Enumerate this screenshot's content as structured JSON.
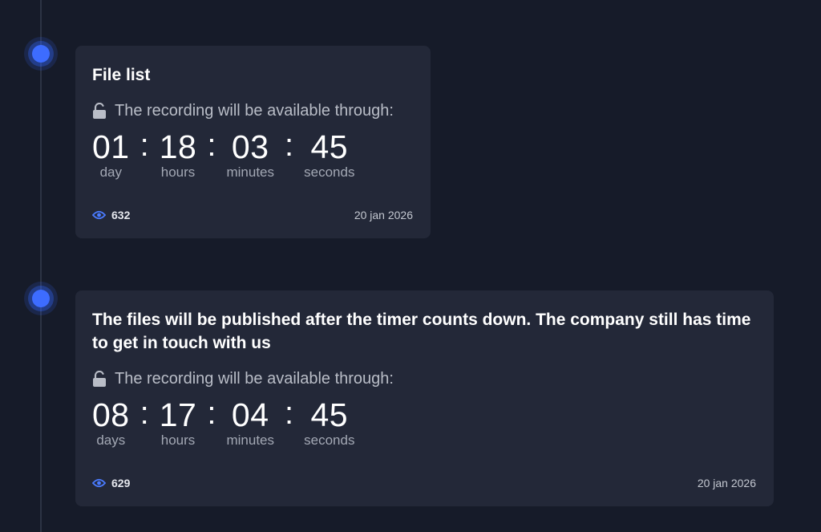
{
  "entries": [
    {
      "title": "File list",
      "availability_text": "The recording will be available through:",
      "countdown": [
        {
          "value": "01",
          "label": "day"
        },
        {
          "value": "18",
          "label": "hours"
        },
        {
          "value": "03",
          "label": "minutes"
        },
        {
          "value": "45",
          "label": "seconds"
        }
      ],
      "separator": ":",
      "views": "632",
      "date": "20 jan 2026"
    },
    {
      "title": "The files will be published after the timer counts down. The company still has time to get in touch with us",
      "availability_text": "The recording will be available through:",
      "countdown": [
        {
          "value": "08",
          "label": "days"
        },
        {
          "value": "17",
          "label": "hours"
        },
        {
          "value": "04",
          "label": "minutes"
        },
        {
          "value": "45",
          "label": "seconds"
        }
      ],
      "separator": ":",
      "views": "629",
      "date": "20 jan 2026"
    }
  ],
  "icons": {
    "lock": "unlocked-lock-icon",
    "views": "eye-icon"
  },
  "colors": {
    "background": "#161b29",
    "card": "#232838",
    "accent": "#3d6cff"
  }
}
